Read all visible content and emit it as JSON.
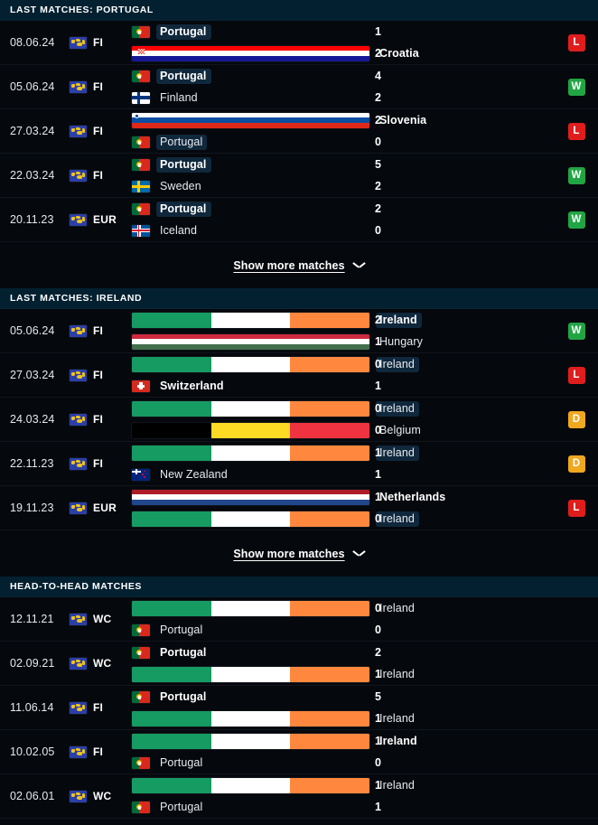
{
  "colors": {
    "header_bg": "#022030",
    "row_bg": "#05080d",
    "win": "#21a544",
    "loss": "#e01d1d",
    "draw": "#f0a81e",
    "highlight": "#10283c"
  },
  "sections": [
    {
      "id": "last-matches-portugal",
      "header": "LAST MATCHES: PORTUGAL",
      "show_more": {
        "label": "Show more matches",
        "icon": "chevron-down-icon"
      },
      "matches": [
        {
          "date": "08.06.24",
          "competition": "FI",
          "competition_icon": "world-flag-icon",
          "home": {
            "name": "Portugal",
            "flag": "portugal",
            "bold": true,
            "highlight": true
          },
          "away": {
            "name": "Croatia",
            "flag": "croatia",
            "bold": true,
            "highlight": false
          },
          "home_score": "1",
          "away_score": "2",
          "result": "L"
        },
        {
          "date": "05.06.24",
          "competition": "FI",
          "competition_icon": "world-flag-icon",
          "home": {
            "name": "Portugal",
            "flag": "portugal",
            "bold": true,
            "highlight": true
          },
          "away": {
            "name": "Finland",
            "flag": "finland",
            "bold": false,
            "highlight": false
          },
          "home_score": "4",
          "away_score": "2",
          "result": "W"
        },
        {
          "date": "27.03.24",
          "competition": "FI",
          "competition_icon": "world-flag-icon",
          "home": {
            "name": "Slovenia",
            "flag": "slovenia",
            "bold": true,
            "highlight": false
          },
          "away": {
            "name": "Portugal",
            "flag": "portugal",
            "bold": false,
            "highlight": true
          },
          "home_score": "2",
          "away_score": "0",
          "result": "L"
        },
        {
          "date": "22.03.24",
          "competition": "FI",
          "competition_icon": "world-flag-icon",
          "home": {
            "name": "Portugal",
            "flag": "portugal",
            "bold": true,
            "highlight": true
          },
          "away": {
            "name": "Sweden",
            "flag": "sweden",
            "bold": false,
            "highlight": false
          },
          "home_score": "5",
          "away_score": "2",
          "result": "W"
        },
        {
          "date": "20.11.23",
          "competition": "EUR",
          "competition_icon": "world-flag-icon",
          "home": {
            "name": "Portugal",
            "flag": "portugal",
            "bold": true,
            "highlight": true
          },
          "away": {
            "name": "Iceland",
            "flag": "iceland",
            "bold": false,
            "highlight": false
          },
          "home_score": "2",
          "away_score": "0",
          "result": "W"
        }
      ]
    },
    {
      "id": "last-matches-ireland",
      "header": "LAST MATCHES: IRELAND",
      "show_more": {
        "label": "Show more matches",
        "icon": "chevron-down-icon"
      },
      "matches": [
        {
          "date": "05.06.24",
          "competition": "FI",
          "competition_icon": "world-flag-icon",
          "home": {
            "name": "Ireland",
            "flag": "ireland",
            "bold": true,
            "highlight": true
          },
          "away": {
            "name": "Hungary",
            "flag": "hungary",
            "bold": false,
            "highlight": false
          },
          "home_score": "2",
          "away_score": "1",
          "result": "W"
        },
        {
          "date": "27.03.24",
          "competition": "FI",
          "competition_icon": "world-flag-icon",
          "home": {
            "name": "Ireland",
            "flag": "ireland",
            "bold": false,
            "highlight": true
          },
          "away": {
            "name": "Switzerland",
            "flag": "switzerland",
            "bold": true,
            "highlight": false
          },
          "home_score": "0",
          "away_score": "1",
          "result": "L"
        },
        {
          "date": "24.03.24",
          "competition": "FI",
          "competition_icon": "world-flag-icon",
          "home": {
            "name": "Ireland",
            "flag": "ireland",
            "bold": false,
            "highlight": true
          },
          "away": {
            "name": "Belgium",
            "flag": "belgium",
            "bold": false,
            "highlight": false
          },
          "home_score": "0",
          "away_score": "0",
          "result": "D"
        },
        {
          "date": "22.11.23",
          "competition": "FI",
          "competition_icon": "world-flag-icon",
          "home": {
            "name": "Ireland",
            "flag": "ireland",
            "bold": false,
            "highlight": true
          },
          "away": {
            "name": "New Zealand",
            "flag": "newzealand",
            "bold": false,
            "highlight": false
          },
          "home_score": "1",
          "away_score": "1",
          "result": "D"
        },
        {
          "date": "19.11.23",
          "competition": "EUR",
          "competition_icon": "world-flag-icon",
          "home": {
            "name": "Netherlands",
            "flag": "netherlands",
            "bold": true,
            "highlight": false
          },
          "away": {
            "name": "Ireland",
            "flag": "ireland",
            "bold": false,
            "highlight": true
          },
          "home_score": "1",
          "away_score": "0",
          "result": "L"
        }
      ]
    },
    {
      "id": "head-to-head-matches",
      "header": "HEAD-TO-HEAD MATCHES",
      "show_more": null,
      "matches": [
        {
          "date": "12.11.21",
          "competition": "WC",
          "competition_icon": "world-flag-icon",
          "home": {
            "name": "Ireland",
            "flag": "ireland",
            "bold": false,
            "highlight": false
          },
          "away": {
            "name": "Portugal",
            "flag": "portugal",
            "bold": false,
            "highlight": false
          },
          "home_score": "0",
          "away_score": "0",
          "result": null
        },
        {
          "date": "02.09.21",
          "competition": "WC",
          "competition_icon": "world-flag-icon",
          "home": {
            "name": "Portugal",
            "flag": "portugal",
            "bold": true,
            "highlight": false
          },
          "away": {
            "name": "Ireland",
            "flag": "ireland",
            "bold": false,
            "highlight": false
          },
          "home_score": "2",
          "away_score": "1",
          "result": null
        },
        {
          "date": "11.06.14",
          "competition": "FI",
          "competition_icon": "world-flag-icon",
          "home": {
            "name": "Portugal",
            "flag": "portugal",
            "bold": true,
            "highlight": false
          },
          "away": {
            "name": "Ireland",
            "flag": "ireland",
            "bold": false,
            "highlight": false
          },
          "home_score": "5",
          "away_score": "1",
          "result": null
        },
        {
          "date": "10.02.05",
          "competition": "FI",
          "competition_icon": "world-flag-icon",
          "home": {
            "name": "Ireland",
            "flag": "ireland",
            "bold": true,
            "highlight": false
          },
          "away": {
            "name": "Portugal",
            "flag": "portugal",
            "bold": false,
            "highlight": false
          },
          "home_score": "1",
          "away_score": "0",
          "result": null
        },
        {
          "date": "02.06.01",
          "competition": "WC",
          "competition_icon": "world-flag-icon",
          "home": {
            "name": "Ireland",
            "flag": "ireland",
            "bold": false,
            "highlight": false
          },
          "away": {
            "name": "Portugal",
            "flag": "portugal",
            "bold": false,
            "highlight": false
          },
          "home_score": "1",
          "away_score": "1",
          "result": null
        }
      ]
    }
  ]
}
